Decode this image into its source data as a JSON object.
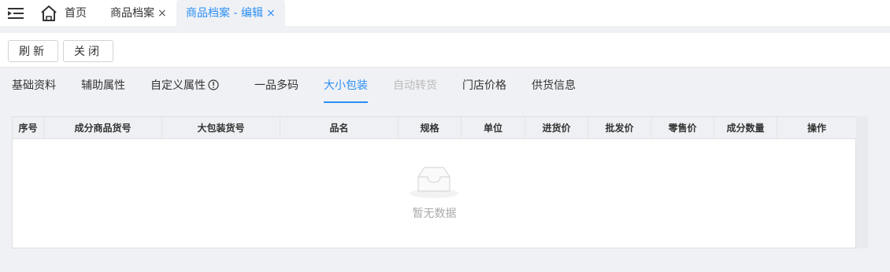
{
  "tabs": [
    {
      "label": "首页"
    },
    {
      "label": "商品档案",
      "close": "×"
    },
    {
      "label": "商品档案 - 编辑",
      "close": "×"
    }
  ],
  "toolbar": {
    "refresh_label": "刷新",
    "close_label": "关闭"
  },
  "subtabs": [
    {
      "label": "基础资料"
    },
    {
      "label": "辅助属性"
    },
    {
      "label": "自定义属性"
    },
    {
      "label": "一品多码"
    },
    {
      "label": "大小包装"
    },
    {
      "label": "自动转货"
    },
    {
      "label": "门店价格"
    },
    {
      "label": "供货信息"
    }
  ],
  "grid": {
    "columns": [
      "序号",
      "成分商品货号",
      "大包装货号",
      "品名",
      "规格",
      "单位",
      "进货价",
      "批发价",
      "零售价",
      "成分数量",
      "操作"
    ],
    "empty_text": "暂无数据"
  },
  "colors": {
    "accent": "#2a8ff3",
    "disabled": "#bbbbbb",
    "background": "#f0f1f5"
  },
  "icons": [
    "menu-fold-icon",
    "home-icon",
    "close-icon",
    "info-circle-icon",
    "empty-inbox-icon"
  ]
}
